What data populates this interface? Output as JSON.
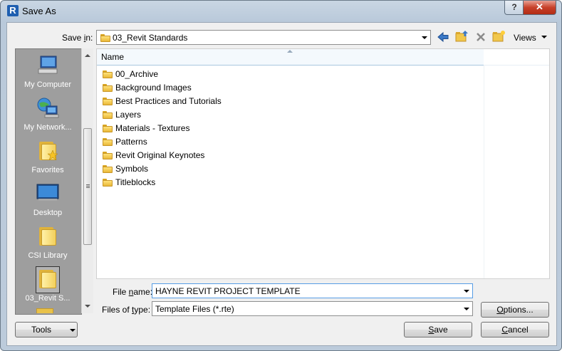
{
  "window": {
    "title": "Save As",
    "app_icon_letter": "R",
    "help_label": "?",
    "close_label": "✕"
  },
  "toolbar": {
    "save_in_label_pre": "Save ",
    "save_in_label_u": "i",
    "save_in_label_post": "n:",
    "save_in_value": "03_Revit Standards",
    "views_label": "Views",
    "icons": [
      "back-arrow-icon",
      "up-folder-icon",
      "delete-icon",
      "new-folder-icon",
      "views-icon"
    ]
  },
  "places": [
    {
      "label": "My Computer",
      "icon": "computer-icon"
    },
    {
      "label": "My Network...",
      "icon": "network-icon"
    },
    {
      "label": "Favorites",
      "icon": "favorites-folder-icon"
    },
    {
      "label": "Desktop",
      "icon": "desktop-icon"
    },
    {
      "label": "CSI Library",
      "icon": "folder-icon"
    },
    {
      "label": "03_Revit S...",
      "icon": "folder-icon"
    }
  ],
  "filelist": {
    "column_name": "Name",
    "items": [
      "00_Archive",
      "Background Images",
      "Best Practices and Tutorials",
      "Layers",
      "Materials - Textures",
      "Patterns",
      "Revit Original Keynotes",
      "Symbols",
      "Titleblocks"
    ]
  },
  "form": {
    "filename_label_pre": "File ",
    "filename_label_u": "n",
    "filename_label_post": "ame:",
    "filename_value": "HAYNE REVIT PROJECT TEMPLATE",
    "filetype_label_pre": "Files of ",
    "filetype_label_u": "t",
    "filetype_label_post": "ype:",
    "filetype_value": "Template Files  (*.rte)"
  },
  "buttons": {
    "tools": "Tools",
    "options_u": "O",
    "options_rest": "ptions...",
    "save_u": "S",
    "save_rest": "ave",
    "cancel_u": "C",
    "cancel_rest": "ancel"
  },
  "colors": {
    "accent_blue": "#3a78c6",
    "sidebar_bg": "#9e9e9e",
    "close_red": "#c7412a"
  }
}
